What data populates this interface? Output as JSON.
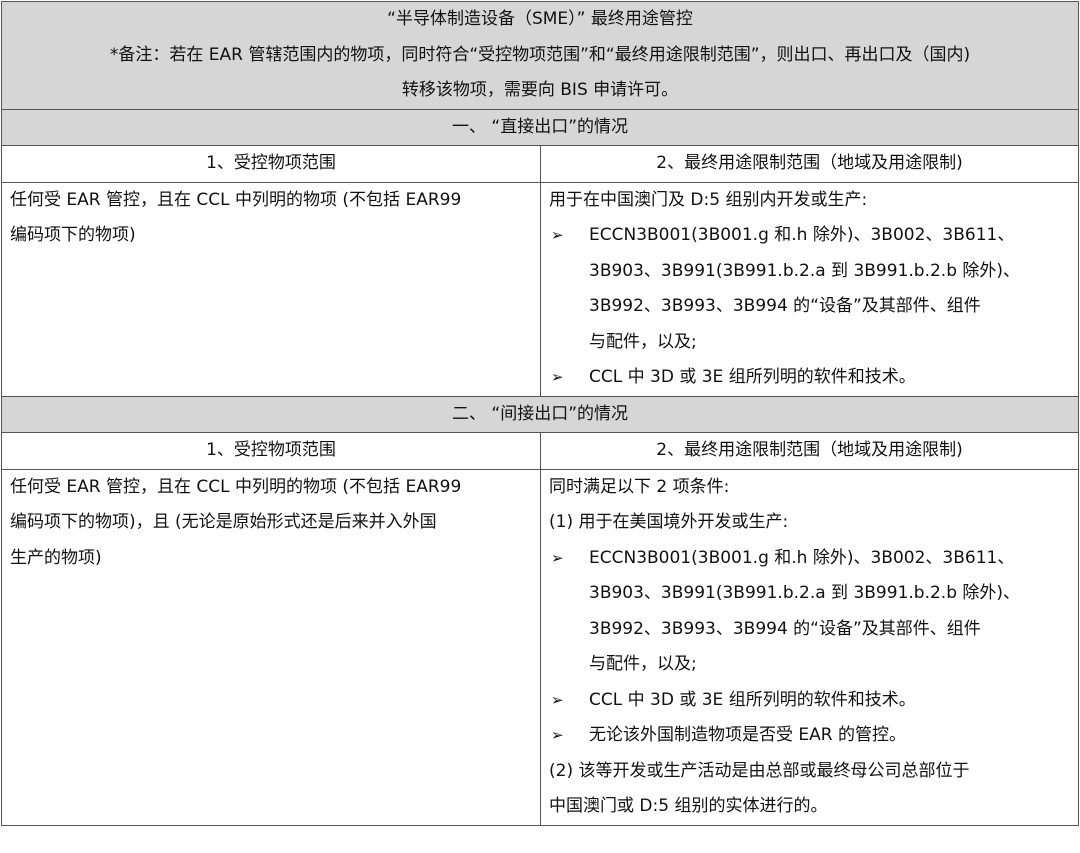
{
  "header": {
    "title": "“半导体制造设备（SME）” 最终用途管控",
    "note_line1": "*备注：若在 EAR 管辖范围内的物项，同时符合“受控物项范围”和“最终用途限制范围”，则出口、再出口及（国内)",
    "note_line2": "转移该物项，需要向 BIS 申请许可。"
  },
  "section1": {
    "title": "一、 “直接出口”的情况",
    "col1_header": "1、受控物项范围",
    "col2_header": "2、最终用途限制范围（地域及用途限制)",
    "scope_lines": [
      "任何受 EAR 管控，且在 CCL 中列明的物项 (不包括 EAR99",
      "编码项下的物项)"
    ],
    "intro": "用于在中国澳门及 D:5 组别内开发或生产:",
    "bullets": [
      {
        "lines": [
          "ECCN3B001(3B001.g 和.h 除外)、3B002、3B611、",
          "3B903、3B991(3B991.b.2.a 到 3B991.b.2.b 除外)、",
          "3B992、3B993、3B994 的“设备”及其部件、组件",
          "与配件，以及;"
        ]
      },
      {
        "lines": [
          "CCL 中 3D 或 3E 组所列明的软件和技术。"
        ]
      }
    ]
  },
  "section2": {
    "title": "二、 “间接出口”的情况",
    "col1_header": "1、受控物项范围",
    "col2_header": "2、最终用途限制范围（地域及用途限制)",
    "scope_lines": [
      "任何受 EAR 管控，且在 CCL 中列明的物项 (不包括 EAR99",
      "编码项下的物项)，且 (无论是原始形式还是后来并入外国",
      "生产的物项)"
    ],
    "intro": "同时满足以下 2 项条件:",
    "cond1": " (1) 用于在美国境外开发或生产:",
    "bullets": [
      {
        "lines": [
          "ECCN3B001(3B001.g 和.h 除外)、3B002、3B611、",
          "3B903、3B991(3B991.b.2.a 到 3B991.b.2.b 除外)、",
          "3B992、3B993、3B994 的“设备”及其部件、组件",
          "与配件，以及;"
        ]
      },
      {
        "lines": [
          "CCL 中 3D 或 3E 组所列明的软件和技术。"
        ]
      },
      {
        "lines": [
          "无论该外国制造物项是否受 EAR 的管控。"
        ]
      }
    ],
    "cond2_lines": [
      " (2) 该等开发或生产活动是由总部或最终母公司总部位于",
      "中国澳门或 D:5 组别的实体进行的。"
    ]
  },
  "icons": {
    "bullet": "arrowhead-bullet-icon"
  }
}
